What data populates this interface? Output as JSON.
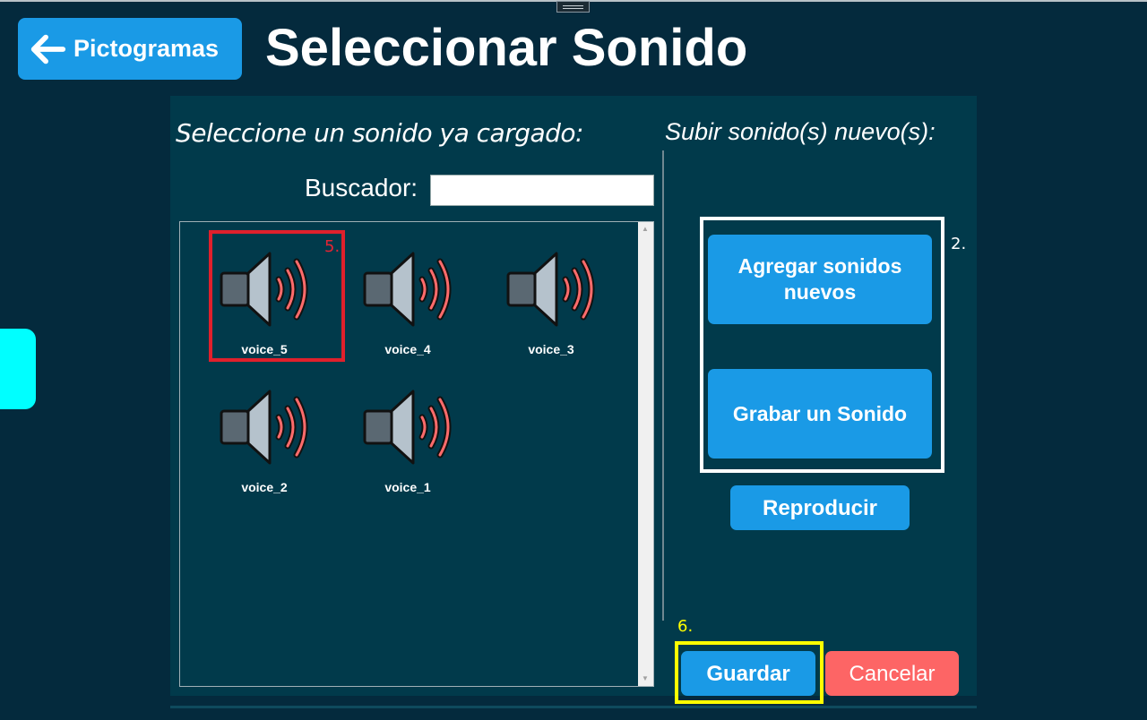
{
  "header": {
    "back_label": "Pictogramas",
    "title": "Seleccionar Sonido"
  },
  "left_section": {
    "heading": "Seleccione un sonido ya cargado:",
    "search_label": "Buscador:",
    "search_value": "",
    "sounds": [
      {
        "name": "voice_5",
        "selected": true
      },
      {
        "name": "voice_4",
        "selected": false
      },
      {
        "name": "voice_3",
        "selected": false
      },
      {
        "name": "voice_2",
        "selected": false
      },
      {
        "name": "voice_1",
        "selected": false
      }
    ]
  },
  "right_section": {
    "heading": "Subir sonido(s) nuevo(s):",
    "add_label": "Agregar sonidos nuevos",
    "record_label": "Grabar un Sonido",
    "play_label": "Reproducir"
  },
  "footer": {
    "save_label": "Guardar",
    "cancel_label": "Cancelar"
  },
  "annotations": {
    "step_selected": "5.",
    "step_upload": "2.",
    "step_save": "6."
  },
  "colors": {
    "background": "#042a3d",
    "panel": "#013a4b",
    "primary_button": "#1a9ae6",
    "cancel_button": "#fd6565",
    "selected_frame": "#e0202c",
    "side_tab": "#00ffff"
  },
  "icons": {
    "back": "arrow-left-icon",
    "sound": "speaker-icon"
  }
}
